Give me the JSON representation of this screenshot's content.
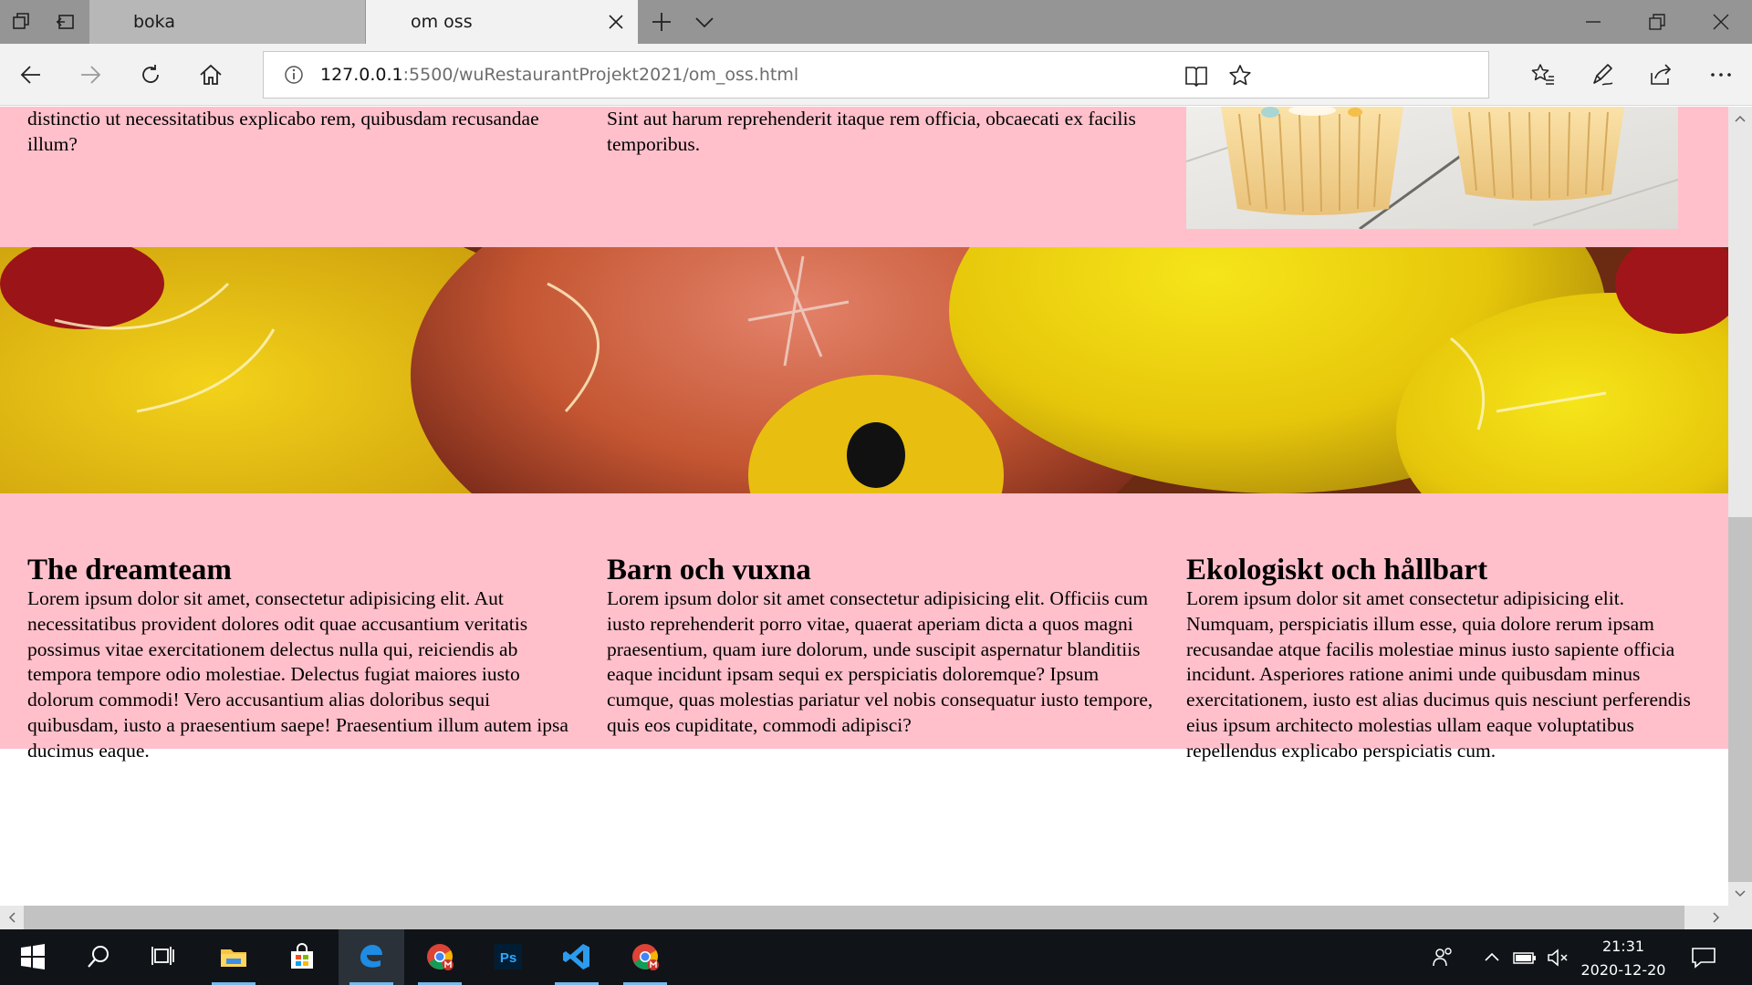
{
  "browser": {
    "tabs": [
      {
        "label": "boka",
        "active": false
      },
      {
        "label": "om oss",
        "active": true
      }
    ],
    "address": {
      "host": "127.0.0.1",
      "path": ":5500/wuRestaurantProjekt2021/om_oss.html"
    }
  },
  "page": {
    "colors": {
      "section_bg": "#ffc0cb",
      "page_bg": "#ffffff"
    },
    "top_row": {
      "col1_text": "distinctio ut necessitatibus explicabo rem, quibusdam recusandae illum?",
      "col2_text": "Sint aut harum reprehenderit itaque rem officia, obcaecati ex facilis temporibus."
    },
    "columns": [
      {
        "heading": "The dreamteam",
        "text": "Lorem ipsum dolor sit amet, consectetur adipisicing elit. Aut necessitatibus provident dolores odit quae accusantium veritatis possimus vitae exercitationem delectus nulla qui, reiciendis ab tempora tempore odio molestiae. Delectus fugiat maiores iusto dolorum commodi! Vero accusantium alias doloribus sequi quibusdam, iusto a praesentium saepe! Praesentium illum autem ipsa ducimus eaque."
      },
      {
        "heading": "Barn och vuxna",
        "text": "Lorem ipsum dolor sit amet consectetur adipisicing elit. Officiis cum iusto reprehenderit porro vitae, quaerat aperiam dicta a quos magni praesentium, quam iure dolorum, unde suscipit aspernatur blanditiis eaque incidunt ipsam sequi ex perspiciatis doloremque? Ipsum cumque, quas molestias pariatur vel nobis consequatur iusto tempore, quis eos cupiditate, commodi adipisci?"
      },
      {
        "heading": "Ekologiskt och hållbart",
        "text": "Lorem ipsum dolor sit amet consectetur adipisicing elit. Numquam, perspiciatis illum esse, quia dolore rerum ipsam recusandae atque facilis molestiae minus iusto sapiente officia incidunt. Asperiores ratione animi unde quibusdam minus exercitationem, iusto est alias ducimus quis nesciunt perferendis eius ipsum architecto molestias ullam eaque voluptatibus repellendus explicabo perspiciatis cum."
      }
    ]
  },
  "taskbar": {
    "apps": [
      "start-icon",
      "search-icon",
      "task-view-icon",
      "file-explorer-icon",
      "store-icon",
      "edge-icon",
      "chrome-icon",
      "photoshop-icon",
      "vscode-icon",
      "chrome-icon"
    ],
    "photoshop_label": "Ps",
    "clock": {
      "time": "21:31",
      "date": "2020-12-20"
    }
  }
}
